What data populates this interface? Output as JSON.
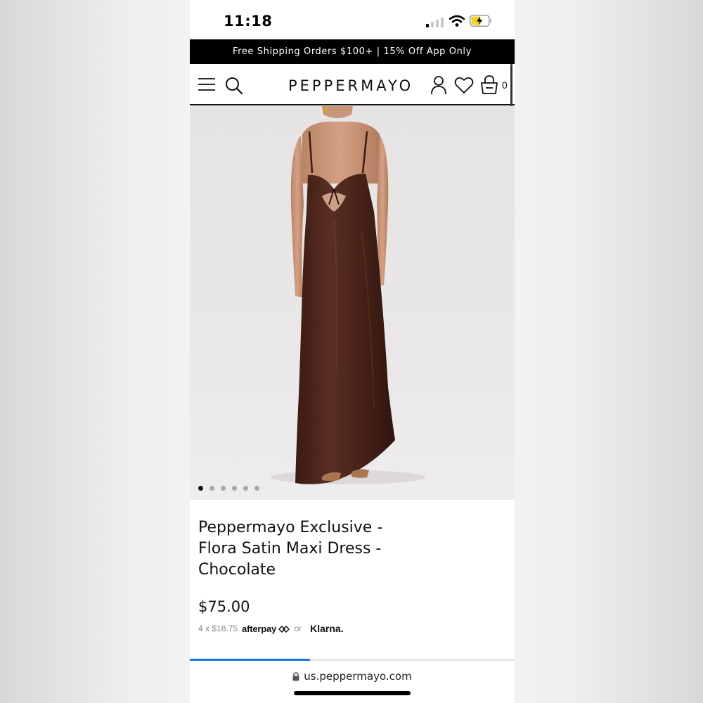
{
  "status_bar": {
    "time": "11:18",
    "signal_bars_on": 1,
    "signal_bars_total": 4,
    "battery_level": 0.55,
    "battery_color": "#f5d22c",
    "charging": true
  },
  "promo": {
    "text": "Free Shipping Orders $100+ | 15% Off App Only"
  },
  "header": {
    "logo": "PEPPERMAYO",
    "cart_count": "0",
    "icons": [
      "menu-icon",
      "search-icon",
      "account-icon",
      "wishlist-icon",
      "cart-icon"
    ]
  },
  "gallery": {
    "image_count": 6,
    "active_index": 0,
    "dress_color": "#4a241a"
  },
  "product": {
    "title": "Peppermayo Exclusive - Flora Satin Maxi Dress - Chocolate",
    "price": "$75.00",
    "installments": "4 x $18.75",
    "afterpay_label": "afterpay",
    "or_text": "or",
    "klarna_label": "Klarna."
  },
  "browser": {
    "url": "us.peppermayo.com",
    "load_progress": 0.37,
    "progress_color": "#1e74e8"
  }
}
